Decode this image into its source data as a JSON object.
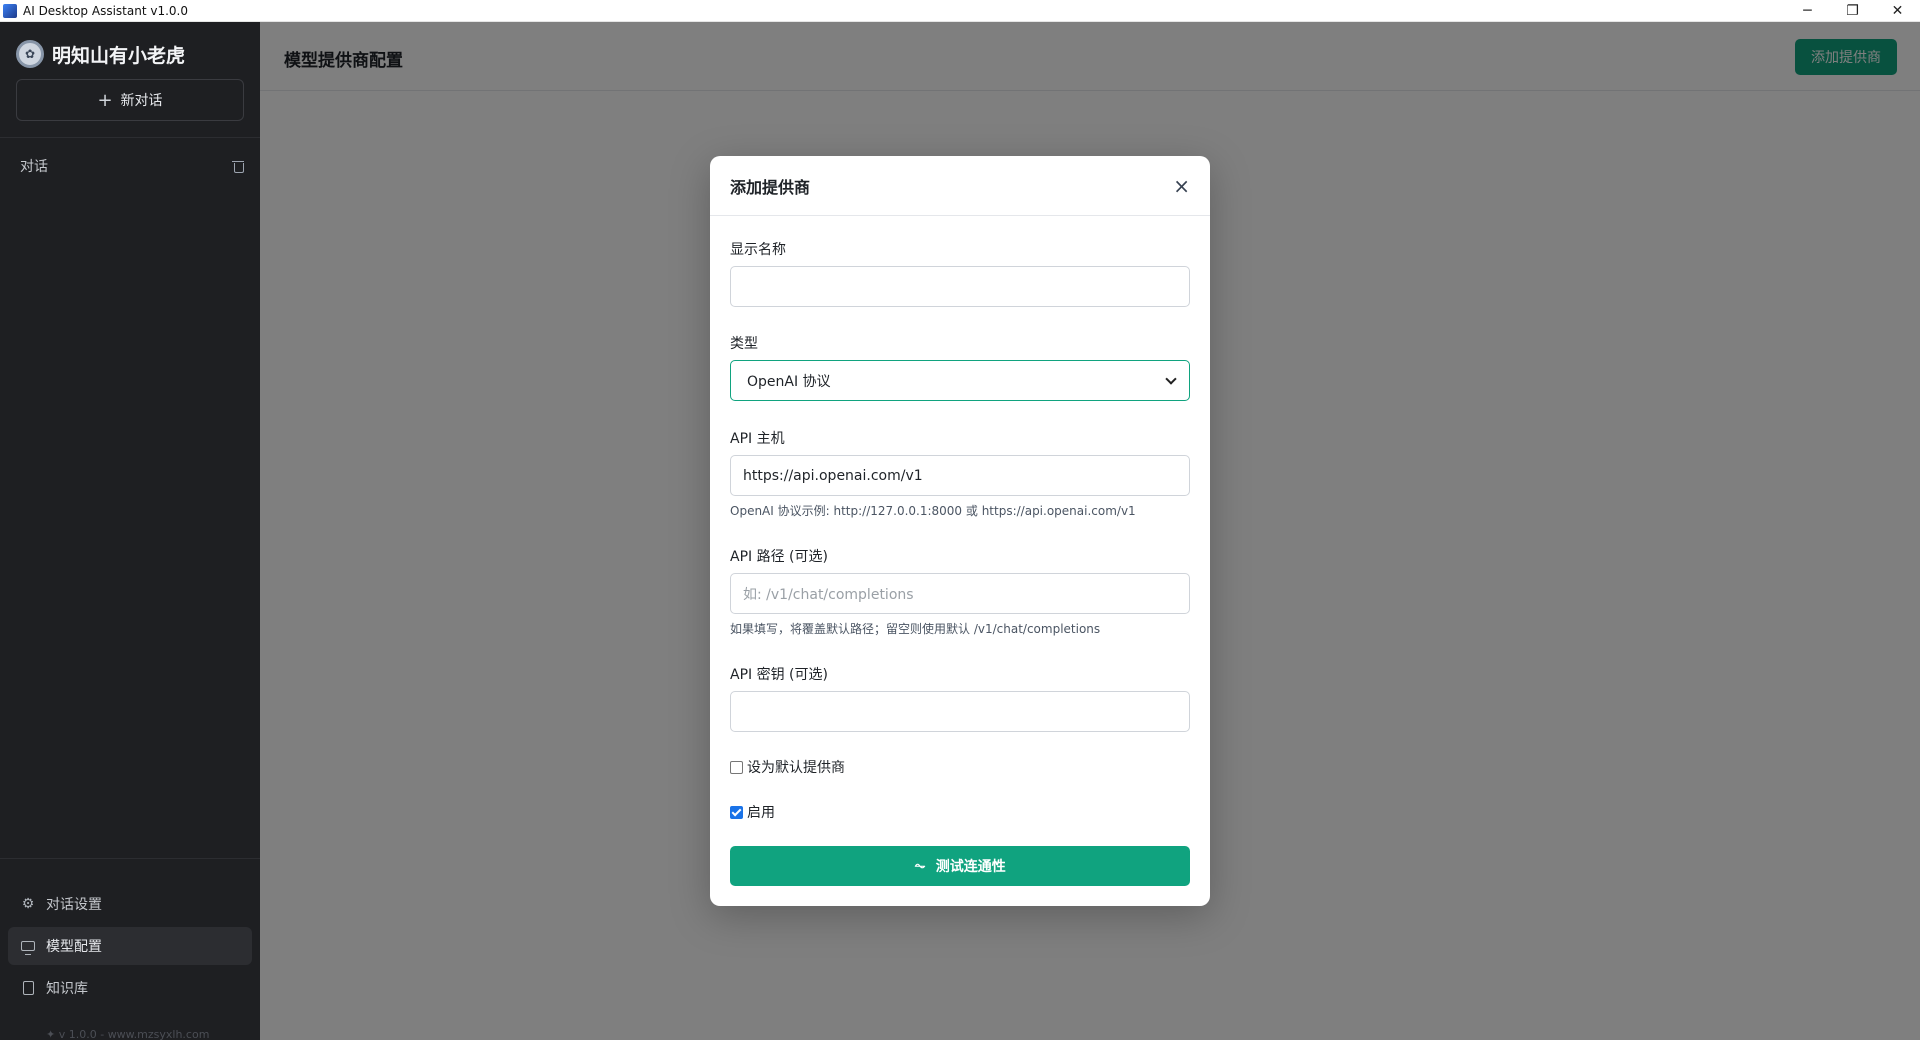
{
  "window": {
    "title": "AI Desktop Assistant v1.0.0",
    "minimize": "─",
    "maximize": "❐",
    "close": "✕"
  },
  "sidebar": {
    "brand_name": "明知山有小老虎",
    "new_chat": "新对话",
    "conversations_label": "对话",
    "nav": [
      {
        "label": "对话设置",
        "icon": "gear-icon"
      },
      {
        "label": "模型配置",
        "icon": "monitor-icon",
        "active": true
      },
      {
        "label": "知识库",
        "icon": "document-icon"
      }
    ],
    "version": "v 1.0.0",
    "site": "www.mzsyxlh.com"
  },
  "main": {
    "title": "模型提供商配置",
    "add_provider": "添加提供商"
  },
  "modal": {
    "title": "添加提供商",
    "display_name": {
      "label": "显示名称",
      "value": ""
    },
    "type": {
      "label": "类型",
      "selected": "OpenAI 协议"
    },
    "api_host": {
      "label": "API 主机",
      "value": "https://api.openai.com/v1",
      "hint": "OpenAI 协议示例: http://127.0.0.1:8000 或 https://api.openai.com/v1"
    },
    "api_path": {
      "label": "API 路径 (可选)",
      "placeholder": "如: /v1/chat/completions",
      "hint": "如果填写，将覆盖默认路径；留空则使用默认 /v1/chat/completions"
    },
    "api_key": {
      "label": "API 密钥 (可选)",
      "value": ""
    },
    "set_default": {
      "label": "设为默认提供商",
      "checked": false
    },
    "enabled": {
      "label": "启用",
      "checked": true
    },
    "test_button": "测试连通性"
  },
  "colors": {
    "accent": "#10a37f",
    "sidebar_bg": "#1e1f22",
    "checkbox": "#1a73e8"
  }
}
